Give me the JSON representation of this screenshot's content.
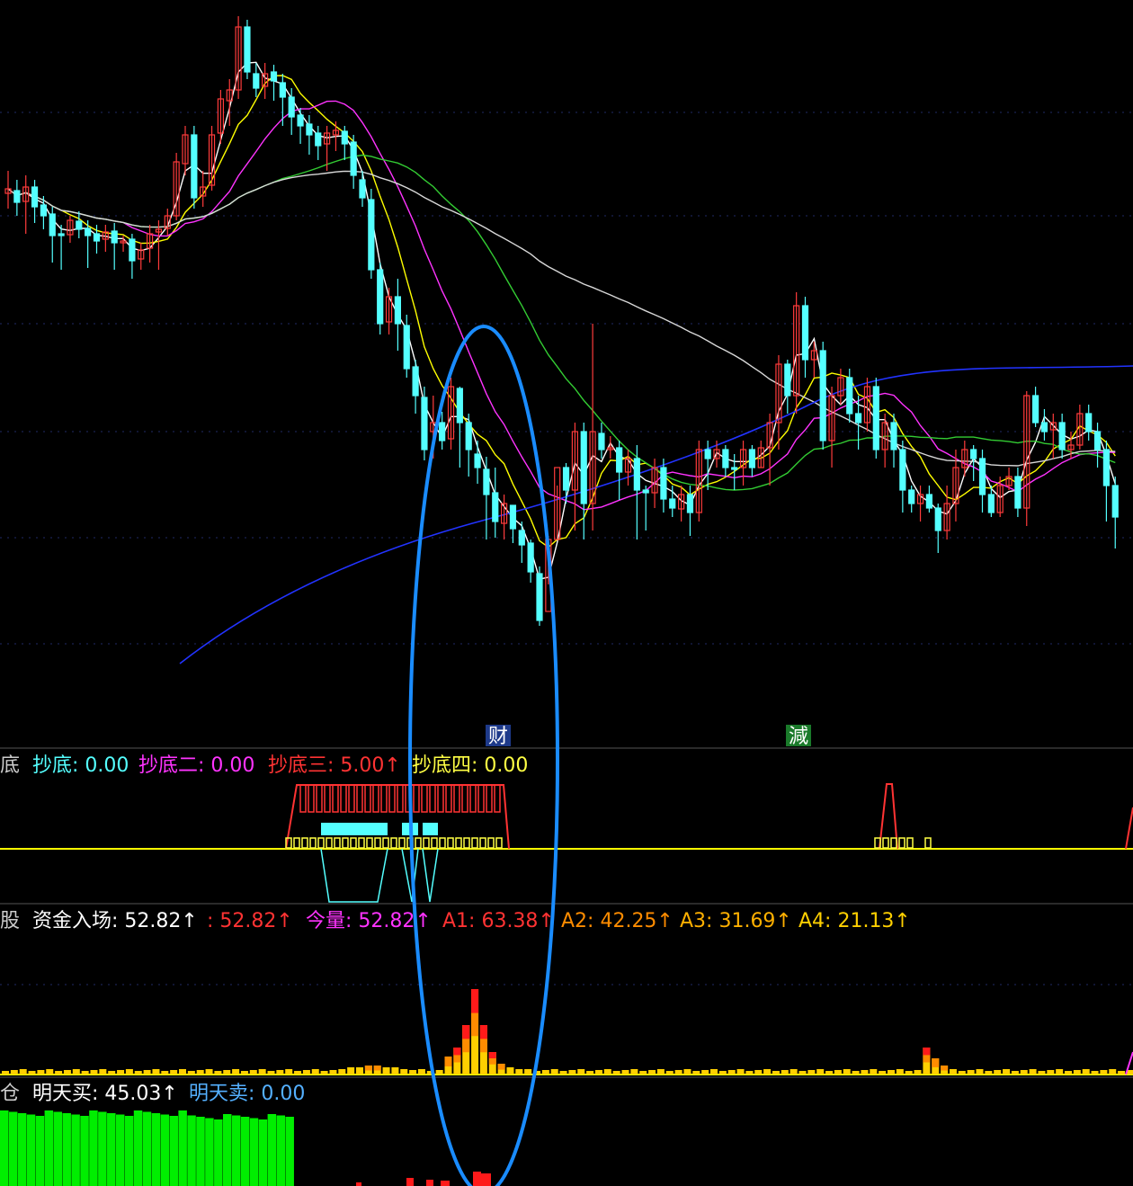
{
  "colors": {
    "bg": "#000000",
    "bull": "#ff3b3b",
    "bear": "#54ffff",
    "ma5": "#ffffff",
    "ma10": "#ffff00",
    "ma20": "#ff33ff",
    "ma60": "#33cc33",
    "ma120": "#d8d8d8",
    "ma250": "#2233ff",
    "highlight": "#1a8cff",
    "grid": "#1f2a66"
  },
  "markers": [
    {
      "text": "财",
      "bg": "#1e3a8a",
      "fg": "#ffffff"
    },
    {
      "text": "減",
      "bg": "#1a7a2a",
      "fg": "#ffffff"
    }
  ],
  "panel2": {
    "labels": [
      {
        "text": "底",
        "color": "#cccccc"
      },
      {
        "text": "抄底: 0.00",
        "color": "#54ffff"
      },
      {
        "text": "抄底二: 0.00",
        "color": "#ff33ff"
      },
      {
        "text": "抄底三: 5.00↑",
        "color": "#ff3333"
      },
      {
        "text": "抄底四: 0.00",
        "color": "#ffff44"
      }
    ]
  },
  "panel3": {
    "labels": [
      {
        "text": "股",
        "color": "#cccccc"
      },
      {
        "text": "资金入场: 52.82↑",
        "color": "#ffffff"
      },
      {
        "text": ": 52.82↑",
        "color": "#ff3333"
      },
      {
        "text": "今量: 52.82↑",
        "color": "#ff33ff"
      },
      {
        "text": "A1: 63.38↑",
        "color": "#ff3333"
      },
      {
        "text": "A2: 42.25↑",
        "color": "#ff8c00"
      },
      {
        "text": "A3: 31.69↑",
        "color": "#ffb000"
      },
      {
        "text": "A4: 21.13↑",
        "color": "#ffd000"
      }
    ]
  },
  "panel4": {
    "labels": [
      {
        "text": "仓",
        "color": "#cccccc"
      },
      {
        "text": "明天买: 45.03↑",
        "color": "#ffffff"
      },
      {
        "text": "明天卖: 0.00",
        "color": "#54b0ff"
      }
    ]
  },
  "chart_data": {
    "type": "candlestick",
    "candles": [
      [
        215,
        210,
        190,
        232
      ],
      [
        212,
        225,
        200,
        240
      ],
      [
        224,
        208,
        195,
        260
      ],
      [
        208,
        230,
        200,
        248
      ],
      [
        228,
        240,
        218,
        255
      ],
      [
        238,
        262,
        230,
        292
      ],
      [
        260,
        262,
        250,
        300
      ],
      [
        261,
        245,
        240,
        270
      ],
      [
        246,
        255,
        235,
        265
      ],
      [
        254,
        262,
        245,
        298
      ],
      [
        260,
        268,
        250,
        282
      ],
      [
        266,
        258,
        250,
        280
      ],
      [
        257,
        270,
        248,
        300
      ],
      [
        270,
        268,
        262,
        280
      ],
      [
        266,
        290,
        260,
        310
      ],
      [
        288,
        278,
        270,
        300
      ],
      [
        276,
        260,
        250,
        292
      ],
      [
        258,
        255,
        245,
        300
      ],
      [
        254,
        240,
        232,
        262
      ],
      [
        240,
        180,
        170,
        245
      ],
      [
        182,
        150,
        140,
        195
      ],
      [
        150,
        220,
        140,
        232
      ],
      [
        218,
        208,
        190,
        230
      ],
      [
        206,
        150,
        140,
        212
      ],
      [
        148,
        110,
        100,
        160
      ],
      [
        112,
        100,
        88,
        140
      ],
      [
        100,
        30,
        18,
        110
      ],
      [
        30,
        80,
        22,
        88
      ],
      [
        82,
        98,
        70,
        108
      ],
      [
        96,
        82,
        70,
        110
      ],
      [
        80,
        90,
        72,
        112
      ],
      [
        92,
        108,
        82,
        140
      ],
      [
        108,
        130,
        98,
        150
      ],
      [
        128,
        140,
        120,
        160
      ],
      [
        138,
        150,
        128,
        172
      ],
      [
        148,
        162,
        140,
        178
      ],
      [
        160,
        148,
        140,
        190
      ],
      [
        150,
        145,
        135,
        168
      ],
      [
        146,
        160,
        140,
        178
      ],
      [
        158,
        195,
        150,
        210
      ],
      [
        200,
        220,
        190,
        230
      ],
      [
        222,
        300,
        210,
        310
      ],
      [
        300,
        360,
        292,
        372
      ],
      [
        358,
        330,
        320,
        372
      ],
      [
        330,
        360,
        310,
        390
      ],
      [
        362,
        410,
        350,
        420
      ],
      [
        408,
        440,
        400,
        460
      ],
      [
        442,
        500,
        430,
        512
      ],
      [
        480,
        470,
        440,
        510
      ],
      [
        470,
        490,
        458,
        500
      ],
      [
        488,
        430,
        420,
        500
      ],
      [
        432,
        470,
        430,
        520
      ],
      [
        470,
        500,
        460,
        530
      ],
      [
        505,
        520,
        490,
        538
      ],
      [
        522,
        550,
        508,
        600
      ],
      [
        548,
        580,
        520,
        598
      ],
      [
        582,
        560,
        550,
        600
      ],
      [
        562,
        588,
        578,
        604
      ],
      [
        590,
        606,
        580,
        626
      ],
      [
        604,
        636,
        600,
        648
      ],
      [
        638,
        690,
        630,
        696
      ],
      [
        680,
        600,
        596,
        650
      ],
      [
        600,
        520,
        540,
        600
      ],
      [
        520,
        545,
        515,
        560
      ],
      [
        545,
        480,
        470,
        590
      ],
      [
        480,
        560,
        470,
        600
      ],
      [
        560,
        480,
        360,
        590
      ],
      [
        482,
        500,
        470,
        510
      ],
      [
        500,
        498,
        485,
        510
      ],
      [
        498,
        525,
        490,
        556
      ],
      [
        525,
        510,
        500,
        540
      ],
      [
        510,
        545,
        495,
        600
      ],
      [
        545,
        548,
        540,
        590
      ],
      [
        548,
        520,
        510,
        565
      ],
      [
        520,
        555,
        510,
        570
      ],
      [
        555,
        565,
        540,
        575
      ],
      [
        566,
        550,
        540,
        580
      ],
      [
        550,
        570,
        540,
        596
      ],
      [
        570,
        500,
        490,
        580
      ],
      [
        500,
        510,
        490,
        545
      ],
      [
        510,
        500,
        490,
        520
      ],
      [
        500,
        520,
        495,
        530
      ],
      [
        520,
        520,
        505,
        545
      ],
      [
        520,
        500,
        490,
        540
      ],
      [
        500,
        520,
        495,
        530
      ],
      [
        520,
        498,
        490,
        520
      ],
      [
        498,
        470,
        460,
        540
      ],
      [
        470,
        405,
        395,
        500
      ],
      [
        405,
        440,
        400,
        460
      ],
      [
        440,
        340,
        325,
        460
      ],
      [
        340,
        400,
        330,
        420
      ],
      [
        400,
        390,
        380,
        420
      ],
      [
        390,
        490,
        380,
        500
      ],
      [
        490,
        440,
        430,
        520
      ],
      [
        440,
        420,
        410,
        450
      ],
      [
        420,
        460,
        410,
        470
      ],
      [
        460,
        470,
        440,
        500
      ],
      [
        470,
        430,
        420,
        480
      ],
      [
        430,
        500,
        420,
        510
      ],
      [
        500,
        470,
        460,
        520
      ],
      [
        470,
        500,
        460,
        520
      ],
      [
        500,
        545,
        490,
        570
      ],
      [
        545,
        560,
        540,
        570
      ],
      [
        560,
        550,
        540,
        580
      ],
      [
        550,
        565,
        540,
        570
      ],
      [
        565,
        590,
        560,
        615
      ],
      [
        590,
        560,
        540,
        600
      ],
      [
        560,
        520,
        500,
        580
      ],
      [
        520,
        500,
        490,
        530
      ],
      [
        500,
        510,
        495,
        535
      ],
      [
        510,
        550,
        500,
        570
      ],
      [
        550,
        570,
        540,
        575
      ],
      [
        570,
        540,
        530,
        575
      ],
      [
        540,
        530,
        520,
        545
      ],
      [
        530,
        565,
        520,
        575
      ],
      [
        565,
        440,
        435,
        585
      ],
      [
        440,
        470,
        430,
        475
      ],
      [
        470,
        480,
        455,
        490
      ],
      [
        478,
        470,
        460,
        510
      ],
      [
        470,
        500,
        460,
        510
      ],
      [
        500,
        495,
        480,
        510
      ],
      [
        495,
        460,
        450,
        500
      ],
      [
        460,
        480,
        450,
        490
      ],
      [
        480,
        500,
        470,
        520
      ],
      [
        500,
        540,
        490,
        580
      ],
      [
        540,
        575,
        530,
        610
      ]
    ],
    "overlays": [
      {
        "name": "MA5"
      },
      {
        "name": "MA10"
      },
      {
        "name": "MA20"
      },
      {
        "name": "MA60"
      },
      {
        "name": "MA120"
      },
      {
        "name": "MA250"
      }
    ],
    "panels": [
      {
        "name": "panel2",
        "values": {
          "抄底": 0.0,
          "抄底二": 0.0,
          "抄底三": 5.0,
          "抄底四": 0.0
        }
      },
      {
        "name": "panel3",
        "values": {
          "资金入场": 52.82,
          "今量": 52.82,
          "A1": 63.38,
          "A2": 42.25,
          "A3": 31.69,
          "A4": 21.13
        }
      },
      {
        "name": "panel4",
        "values": {
          "明天买": 45.03,
          "明天卖": 0.0
        }
      }
    ]
  }
}
